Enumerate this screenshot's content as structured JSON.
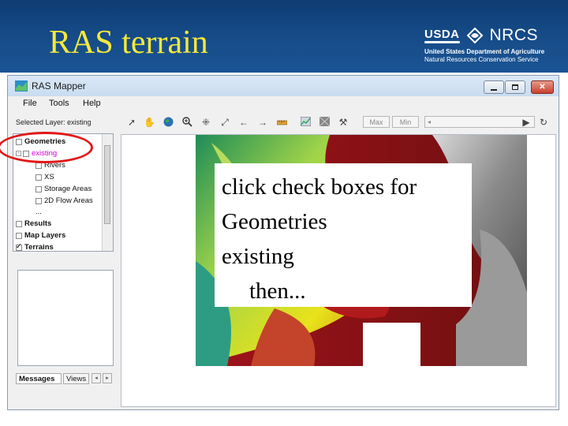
{
  "slide": {
    "title": "RAS terrain",
    "logo": {
      "usda": "USDA",
      "nrcs": "NRCS",
      "line1": "United States Department of Agriculture",
      "line2": "Natural Resources Conservation Service"
    }
  },
  "window": {
    "title": "RAS Mapper",
    "menus": [
      "File",
      "Tools",
      "Help"
    ],
    "toolbar": {
      "selected_layer": "Selected Layer: existing",
      "max_label": "Max",
      "min_label": "Min"
    },
    "layer_tree": {
      "geometries": "Geometries",
      "existing": "existing",
      "rivers": "Rivers",
      "xs": "XS",
      "storage_areas": "Storage Areas",
      "flow_areas": "2D Flow Areas",
      "ellipsis": "...",
      "results": "Results",
      "map_layers": "Map Layers",
      "terrains": "Terrains"
    },
    "tabs": {
      "messages": "Messages",
      "views": "Views"
    }
  },
  "callout": {
    "line1": "click check boxes for",
    "line2": "Geometries",
    "line3": "existing",
    "line4": "then..."
  },
  "colors": {
    "header_bg": "#154a86",
    "title": "#f5e83a",
    "annotation": "#e01818",
    "existing_label": "#d000d0"
  }
}
